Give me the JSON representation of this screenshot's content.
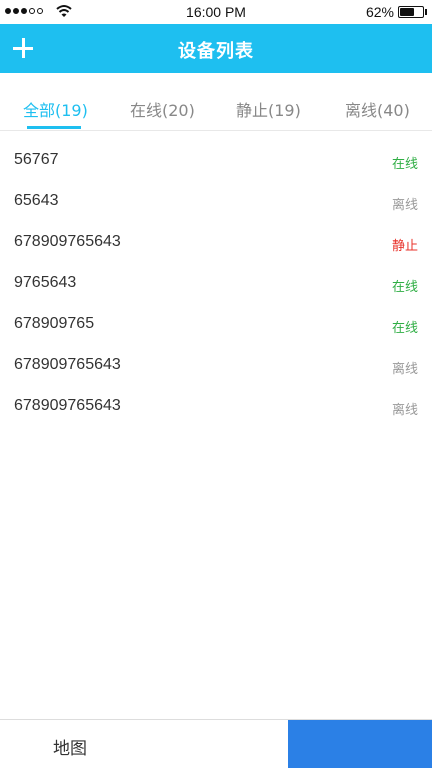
{
  "status_bar": {
    "time": "16:00  PM",
    "battery": "62%",
    "battery_level": 0.62,
    "signal_bars_filled": 3,
    "signal_bars_total": 5
  },
  "header": {
    "add_icon": "plus-icon",
    "title": "设备列表"
  },
  "tabs": [
    {
      "label": "全部(19)",
      "active": true
    },
    {
      "label": "在线(20)",
      "active": false
    },
    {
      "label": "静止(19)",
      "active": false
    },
    {
      "label": "离线(40)",
      "active": false
    }
  ],
  "colors": {
    "accent": "#1ebff0",
    "online": "#2fae44",
    "stopped": "#e8332b",
    "offline": "#999999",
    "bottom_active": "#2b80e6"
  },
  "devices": [
    {
      "id": "56767",
      "status": "在线",
      "status_type": "online"
    },
    {
      "id": "65643",
      "status": "离线",
      "status_type": "offline"
    },
    {
      "id": "678909765643",
      "status": "静止",
      "status_type": "stopped"
    },
    {
      "id": "9765643",
      "status": "在线",
      "status_type": "online"
    },
    {
      "id": "678909765",
      "status": "在线",
      "status_type": "online"
    },
    {
      "id": "678909765643",
      "status": "离线",
      "status_type": "offline"
    },
    {
      "id": "678909765643",
      "status": "离线",
      "status_type": "offline"
    }
  ],
  "bottom_nav": {
    "map_label": "地图"
  }
}
